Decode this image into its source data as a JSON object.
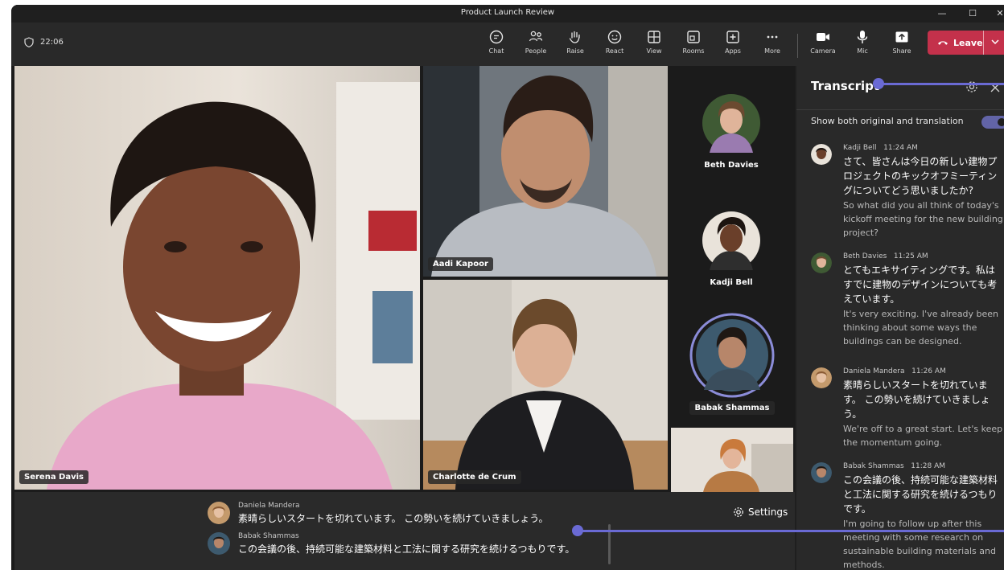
{
  "window": {
    "title": "Product Launch Review",
    "controls": [
      "—",
      "☐",
      "✕"
    ]
  },
  "toolbar": {
    "timer": "22:06",
    "buttons": [
      {
        "label": "Chat",
        "icon": "chat-icon"
      },
      {
        "label": "People",
        "icon": "people-icon"
      },
      {
        "label": "Raise",
        "icon": "hand-icon"
      },
      {
        "label": "React",
        "icon": "smiley-icon"
      },
      {
        "label": "View",
        "icon": "grid-icon"
      },
      {
        "label": "Rooms",
        "icon": "rooms-icon"
      },
      {
        "label": "Apps",
        "icon": "plus-box-icon"
      },
      {
        "label": "More",
        "icon": "ellipsis-icon"
      },
      {
        "label": "Camera",
        "icon": "camera-icon"
      },
      {
        "label": "Mic",
        "icon": "microphone-icon"
      },
      {
        "label": "Share",
        "icon": "share-icon"
      }
    ],
    "leave_label": "Leave",
    "leave_color": "#c4314b"
  },
  "participants": {
    "main": "Serena Davis",
    "top_right": "Aadi Kapoor",
    "bottom_right": "Charlotte de Crum",
    "side": [
      "Beth Davies",
      "Kadji Bell",
      "Babak Shammas"
    ]
  },
  "captions": {
    "settings_label": "Settings",
    "lines": [
      {
        "speaker": "Daniela Mandera",
        "text": "素晴らしいスタートを切れています。 この勢いを続けていきましょう。"
      },
      {
        "speaker": "Babak Shammas",
        "text": "この会議の後、持続可能な建築材料と工法に関する研究を続けるつもりです。"
      }
    ]
  },
  "transcript": {
    "title": "Transcript",
    "toggle_label": "Show both original and translation",
    "toggle_on": true,
    "accent": "#6264a7",
    "entries": [
      {
        "speaker": "Kadji Bell",
        "time": "11:24 AM",
        "original": "さて、皆さんは今日の新しい建物プロジェクトのキックオフミーティングについてどう思いましたか?",
        "translation": "So what did you all think of today's kickoff meeting for the new building project?"
      },
      {
        "speaker": "Beth Davies",
        "time": "11:25 AM",
        "original": "とてもエキサイティングです。私はすでに建物のデザインについても考えています。",
        "translation": "It's very exciting. I've already been thinking about some ways the buildings can be designed."
      },
      {
        "speaker": "Daniela Mandera",
        "time": "11:26 AM",
        "original": "素晴らしいスタートを切れています。 この勢いを続けていきましょう。",
        "translation": "We're off to a great start. Let's keep the momentum going."
      },
      {
        "speaker": "Babak Shammas",
        "time": "11:28 AM",
        "original": "この会議の後、持続可能な建築材料と工法に関する研究を続けるつもりです。",
        "translation": "I'm going to follow up after this meeting with some research on sustainable building materials and methods."
      }
    ]
  }
}
